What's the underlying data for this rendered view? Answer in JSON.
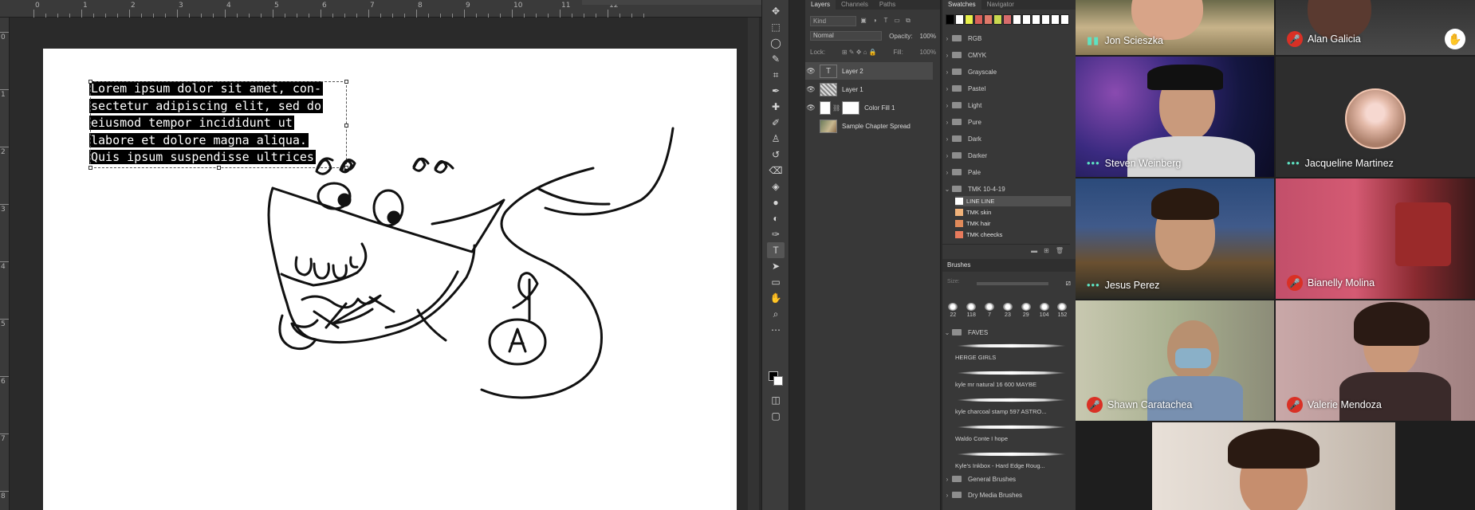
{
  "ruler": {
    "h_numbers": [
      "0",
      "1",
      "2",
      "3",
      "4",
      "5",
      "6",
      "7",
      "8",
      "9",
      "10",
      "11",
      "12"
    ],
    "v_numbers": [
      "0",
      "1",
      "2",
      "3",
      "4",
      "5",
      "6",
      "7",
      "8"
    ]
  },
  "document": {
    "text_lines": [
      "Lorem ipsum dolor sit amet, con-",
      "sectetur adipiscing elit, sed do",
      "eiusmod tempor incididunt ut",
      "labore et dolore magna aliqua.",
      "Quis ipsum suspendisse ultrices"
    ]
  },
  "layers_panel": {
    "tabs": [
      "Layers",
      "Channels",
      "Paths"
    ],
    "kind_placeholder": "Kind",
    "blend_mode": "Normal",
    "opacity_label": "Opacity:",
    "opacity_value": "100%",
    "lock_label": "Lock:",
    "fill_label": "Fill:",
    "fill_value": "100%",
    "layers": [
      {
        "name": "Layer 2",
        "type": "text",
        "visible": true,
        "selected": true
      },
      {
        "name": "Layer 1",
        "type": "raster",
        "visible": true,
        "selected": false
      },
      {
        "name": "Color Fill 1",
        "type": "fill",
        "visible": true,
        "selected": false
      },
      {
        "name": "Sample Chapter Spread",
        "type": "photo",
        "visible": false,
        "selected": false
      }
    ]
  },
  "swatches_panel": {
    "tabs": [
      "Swatches",
      "Navigator"
    ],
    "recent_colors": [
      "#000000",
      "#ffffff",
      "#e8f04a",
      "#d9605a",
      "#e07a6a",
      "#c9d850",
      "#d76c6c",
      "#ffffff",
      "#ffffff",
      "#ffffff",
      "#ffffff",
      "#ffffff",
      "#ffffff"
    ],
    "folders": [
      "RGB",
      "CMYK",
      "Grayscale",
      "Pastel",
      "Light",
      "Pure",
      "Dark",
      "Darker",
      "Pale",
      "TMK 10-4-19"
    ],
    "open_folder_items": [
      {
        "label": "LINE LINE",
        "color": "#ffffff"
      },
      {
        "label": "TMK skin",
        "color": "#f0b27a"
      },
      {
        "label": "TMK hair",
        "color": "#e08a5a"
      },
      {
        "label": "TMK cheecks",
        "color": "#e77a5c"
      }
    ]
  },
  "brushes_panel": {
    "title": "Brushes",
    "size_label": "Size:",
    "presets": [
      "22",
      "118",
      "7",
      "23",
      "29",
      "104",
      "152"
    ],
    "group_open": "FAVES",
    "brushes": [
      "HERGE GIRLS",
      "kyle mr natural 16 600 MAYBE",
      "kyle charcoal stamp 597 ASTRO...",
      "Waldo Conte I hope",
      "Kyle's Inkbox - Hard Edge Roug..."
    ],
    "groups_closed": [
      "General Brushes",
      "Dry Media Brushes"
    ]
  },
  "video_call": {
    "participants": [
      {
        "name": "Jon Scieszka",
        "mic": "on"
      },
      {
        "name": "Alan Galicia",
        "mic": "off"
      },
      {
        "name": "Steven Weinberg",
        "mic": "on"
      },
      {
        "name": "Jacqueline Martinez",
        "mic": "on"
      },
      {
        "name": "Jesus Perez",
        "mic": "on"
      },
      {
        "name": "Bianelly Molina",
        "mic": "off"
      },
      {
        "name": "Shawn Caratachea",
        "mic": "off"
      },
      {
        "name": "Valerie Mendoza",
        "mic": "off"
      }
    ]
  }
}
